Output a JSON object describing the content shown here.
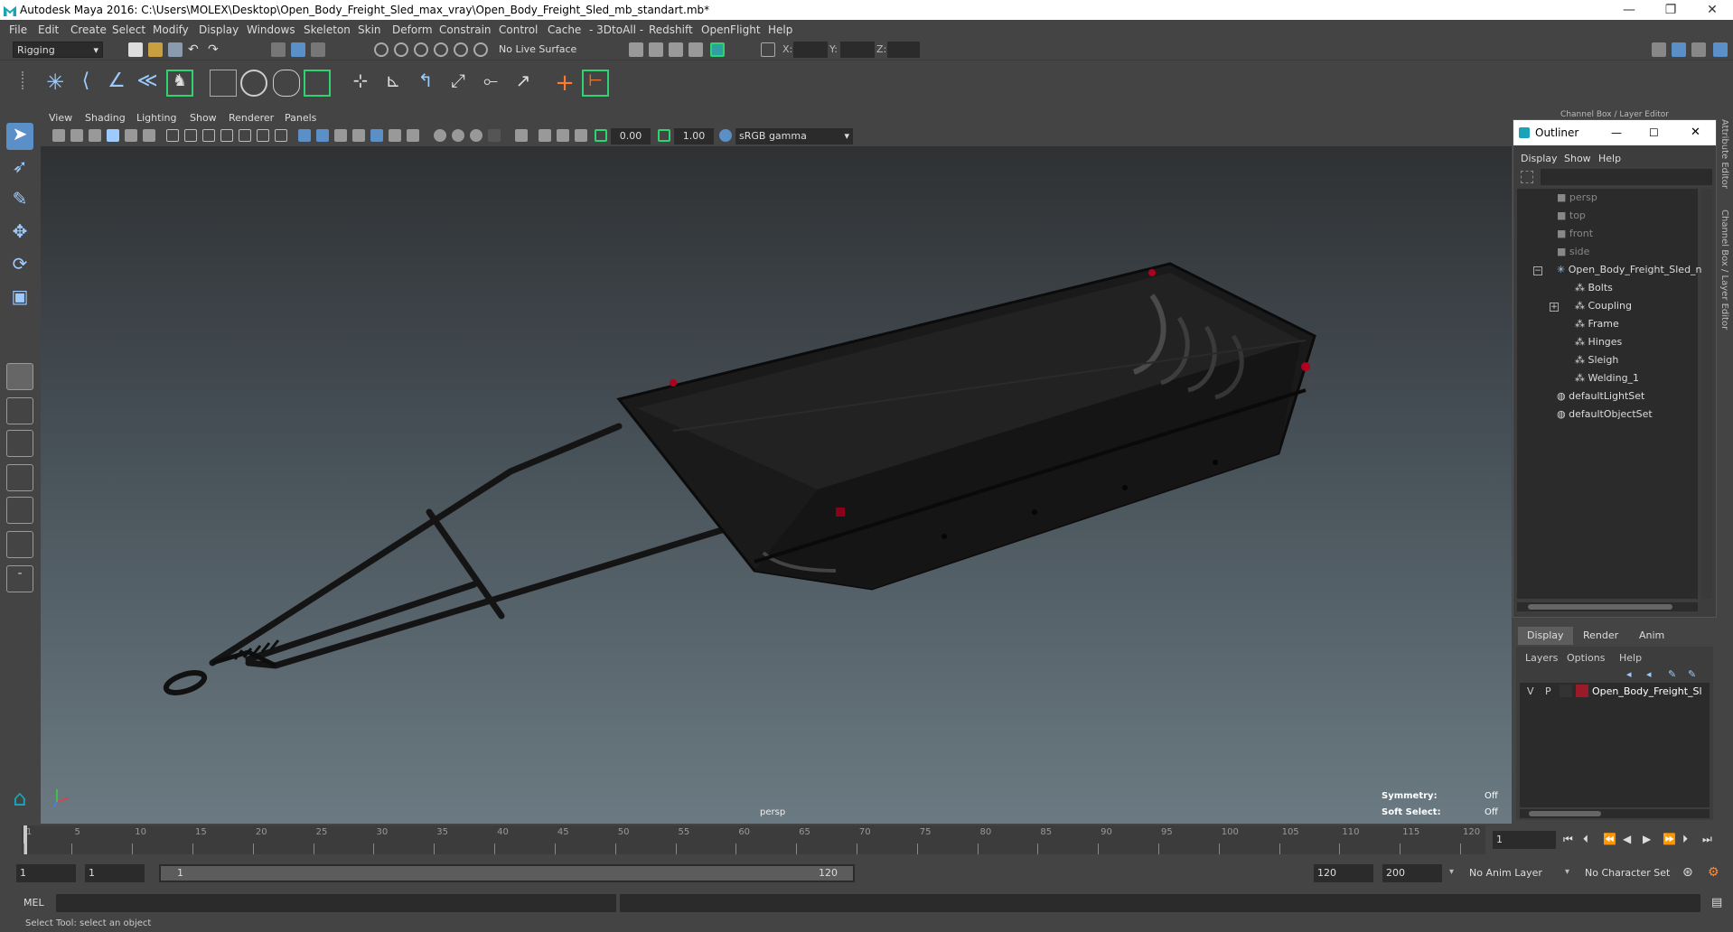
{
  "window": {
    "title": "Autodesk Maya 2016: C:\\Users\\MOLEX\\Desktop\\Open_Body_Freight_Sled_max_vray\\Open_Body_Freight_Sled_mb_standart.mb*",
    "minimize": "—",
    "restore": "❐",
    "close": "✕"
  },
  "menubar": [
    "File",
    "Edit",
    "Create",
    "Select",
    "Modify",
    "Display",
    "Windows",
    "Skeleton",
    "Skin",
    "Deform",
    "Constrain",
    "Control",
    "Cache",
    "- 3DtoAll -",
    "Redshift",
    "OpenFlight",
    "Help"
  ],
  "statusline": {
    "menuset": "Rigging",
    "live_surface": "No Live Surface",
    "x_label": "X:",
    "y_label": "Y:",
    "z_label": "Z:"
  },
  "panel": {
    "menus": [
      "View",
      "Shading",
      "Lighting",
      "Show",
      "Renderer",
      "Panels"
    ],
    "exposure": "0.00",
    "gamma": "1.00",
    "colorspace": "sRGB gamma"
  },
  "viewport": {
    "camera": "persp",
    "symmetry_label": "Symmetry:",
    "symmetry_value": "Off",
    "soft_select_label": "Soft Select:",
    "soft_select_value": "Off"
  },
  "channel_box_header": "Channel Box / Layer Editor",
  "outliner": {
    "title": "Outliner",
    "menus": [
      "Display",
      "Show",
      "Help"
    ],
    "items": [
      {
        "label": "persp",
        "icon": "camera-icon",
        "dim": true
      },
      {
        "label": "top",
        "icon": "camera-icon",
        "dim": true
      },
      {
        "label": "front",
        "icon": "camera-icon",
        "dim": true
      },
      {
        "label": "side",
        "icon": "camera-icon",
        "dim": true
      },
      {
        "label": "Open_Body_Freight_Sled_nc",
        "icon": "group-icon",
        "dim": false
      },
      {
        "label": "Bolts",
        "icon": "mesh-icon",
        "dim": false
      },
      {
        "label": "Coupling",
        "icon": "mesh-icon",
        "dim": false
      },
      {
        "label": "Frame",
        "icon": "mesh-icon",
        "dim": false
      },
      {
        "label": "Hinges",
        "icon": "mesh-icon",
        "dim": false
      },
      {
        "label": "Sleigh",
        "icon": "mesh-icon",
        "dim": false
      },
      {
        "label": "Welding_1",
        "icon": "mesh-icon",
        "dim": false
      },
      {
        "label": "defaultLightSet",
        "icon": "set-icon",
        "dim": false
      },
      {
        "label": "defaultObjectSet",
        "icon": "set-icon",
        "dim": false
      }
    ]
  },
  "layer_editor": {
    "tabs": [
      "Display",
      "Render",
      "Anim"
    ],
    "menus": [
      "Layers",
      "Options",
      "Help"
    ],
    "layer": {
      "v": "V",
      "p": "P",
      "name": "Open_Body_Freight_Sl",
      "color": "#9b1a2a"
    }
  },
  "side_tabs": [
    "Attribute Editor",
    "Channel Box / Layer Editor"
  ],
  "timeline": {
    "ticks": [
      "1",
      "5",
      "10",
      "15",
      "20",
      "25",
      "30",
      "35",
      "40",
      "45",
      "50",
      "55",
      "60",
      "65",
      "70",
      "75",
      "80",
      "85",
      "90",
      "95",
      "100",
      "105",
      "110",
      "115",
      "120"
    ],
    "current_frame": "1",
    "range_start": "1",
    "range_start_inner": "1",
    "slider_start": "1",
    "slider_end": "120",
    "range_end_inner": "120",
    "range_end": "200",
    "anim_layer": "No Anim Layer",
    "character_set": "No Character Set"
  },
  "command": {
    "label": "MEL"
  },
  "help_line": "Select Tool: select an object",
  "colors": {
    "accent": "#1aa3b8",
    "highlight_blue": "#5b8fc7",
    "selected_green": "#2fd36f"
  }
}
